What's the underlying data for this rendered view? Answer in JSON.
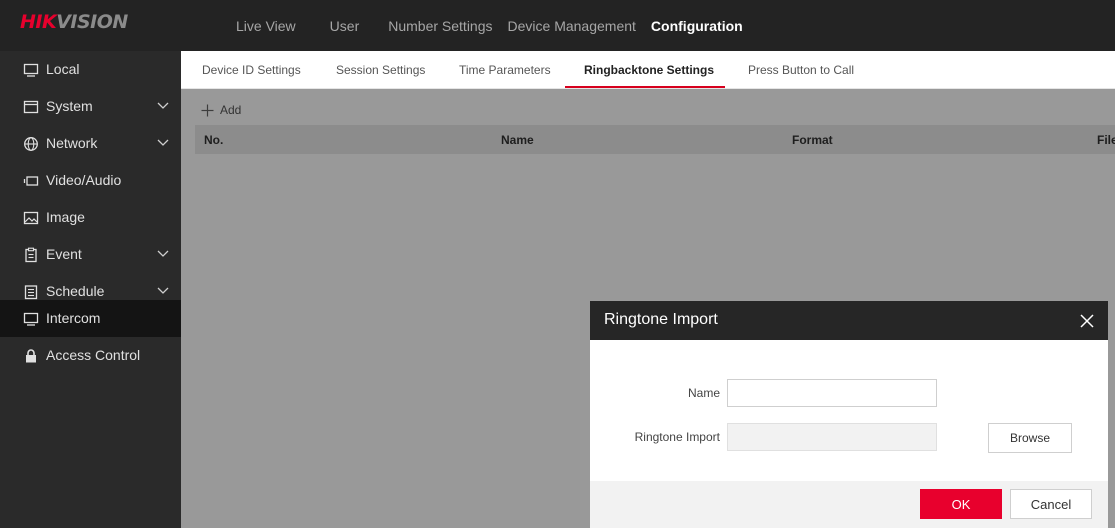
{
  "brand": {
    "logo_red": "HIK",
    "logo_gray": "VISION",
    "accent": "#e8002d"
  },
  "topnav": {
    "items": [
      {
        "label": "Live View"
      },
      {
        "label": "User"
      },
      {
        "label": "Number Settings"
      },
      {
        "label": "Device Management"
      },
      {
        "label": "Configuration",
        "active": true
      }
    ]
  },
  "sidebar": {
    "items": [
      {
        "label": "Local",
        "icon": "monitor-icon"
      },
      {
        "label": "System",
        "icon": "system-icon",
        "expandable": true
      },
      {
        "label": "Network",
        "icon": "globe-icon",
        "expandable": true
      },
      {
        "label": "Video/Audio",
        "icon": "video-icon"
      },
      {
        "label": "Image",
        "icon": "image-icon"
      },
      {
        "label": "Event",
        "icon": "event-icon",
        "expandable": true
      },
      {
        "label": "Schedule",
        "icon": "schedule-icon",
        "expandable": true
      },
      {
        "label": "Intercom",
        "icon": "intercom-icon",
        "active": true
      },
      {
        "label": "Access Control",
        "icon": "lock-icon"
      }
    ]
  },
  "tabs": {
    "items": [
      {
        "label": "Device ID Settings"
      },
      {
        "label": "Session Settings"
      },
      {
        "label": "Time Parameters"
      },
      {
        "label": "Ringbacktone Settings",
        "active": true
      },
      {
        "label": "Press Button to Call"
      }
    ]
  },
  "content": {
    "add_label": "Add",
    "columns": [
      "No.",
      "Name",
      "Format",
      "File"
    ]
  },
  "dialog": {
    "title": "Ringtone Import",
    "name_label": "Name",
    "name_value": "",
    "import_label": "Ringtone Import",
    "browse_label": "Browse",
    "ok_label": "OK",
    "cancel_label": "Cancel"
  }
}
